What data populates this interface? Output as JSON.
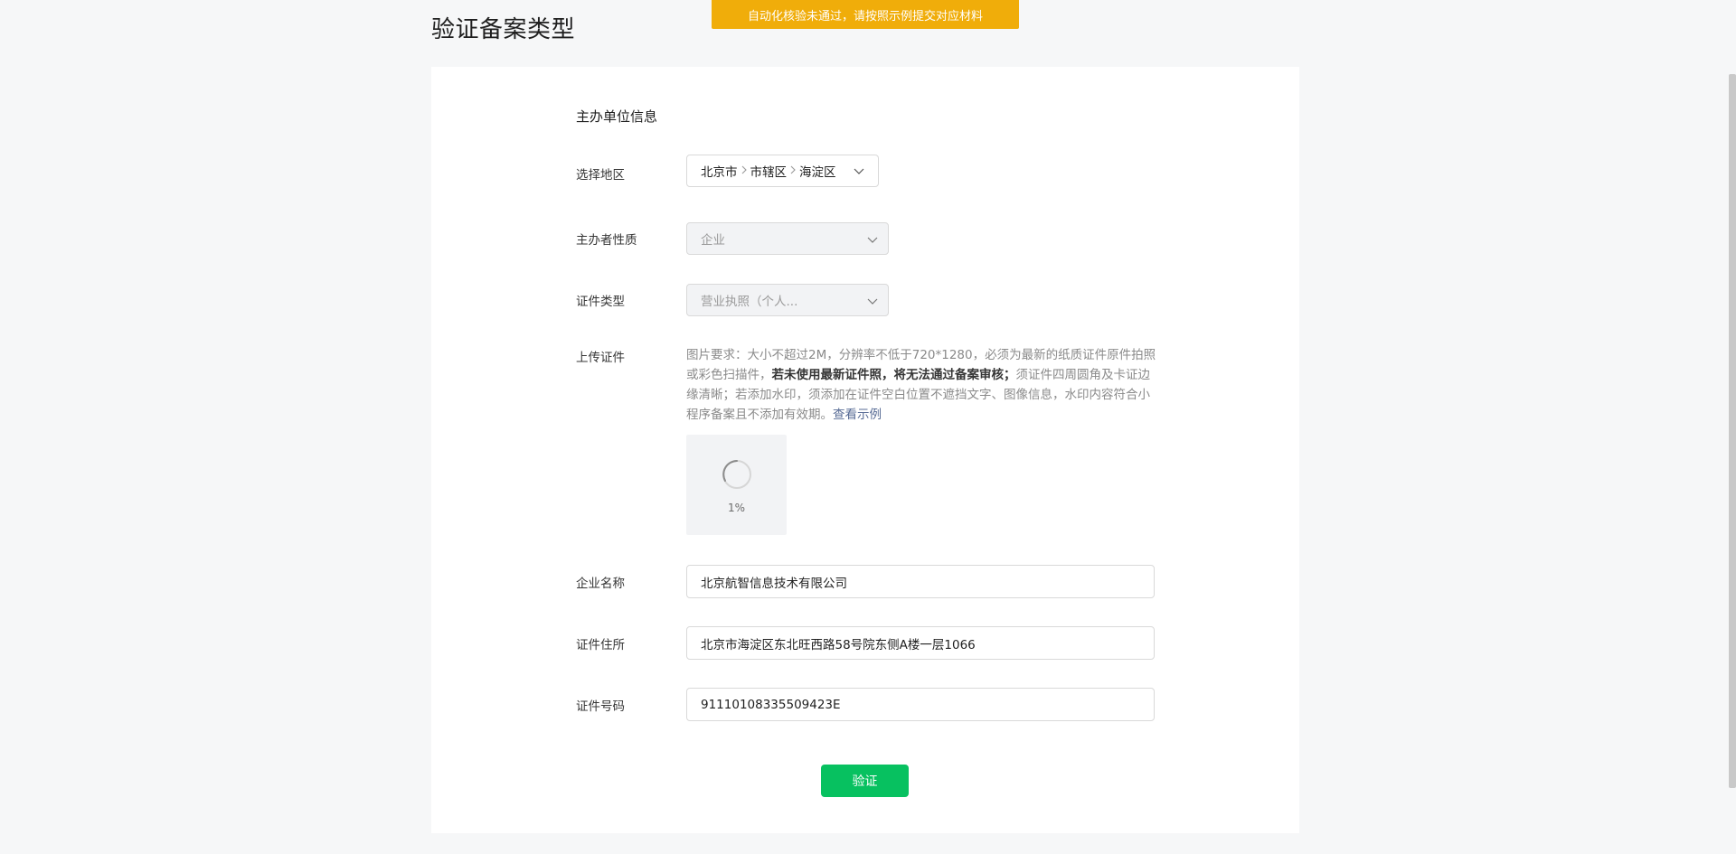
{
  "toast": {
    "message": "自动化核验未通过，请按照示例提交对应材料",
    "color": "#f0ad0a"
  },
  "page": {
    "title": "验证备案类型"
  },
  "form": {
    "section_title": "主办单位信息",
    "region": {
      "label": "选择地区",
      "parts": [
        "北京市",
        "市辖区",
        "海淀区"
      ],
      "separator": ">"
    },
    "organizer_nature": {
      "label": "主办者性质",
      "value": "企业"
    },
    "certificate_type": {
      "label": "证件类型",
      "value": "营业执照（个人..."
    },
    "upload": {
      "label": "上传证件",
      "desc_part1": "图片要求：大小不超过2M，分辨率不低于720*1280，必须为最新的纸质证件原件拍照或彩色扫描件，",
      "desc_bold": "若未使用最新证件照，将无法通过备案审核；",
      "desc_part2": "须证件四周圆角及卡证边缘清晰；若添加水印，须添加在证件空白位置不遮挡文字、图像信息，水印内容符合小程序备案且不添加有效期。",
      "link_text": "查看示例",
      "progress_text": "1%",
      "progress": 0.01
    },
    "company_name": {
      "label": "企业名称",
      "value": "北京航智信息技术有限公司"
    },
    "certificate_address": {
      "label": "证件住所",
      "value": "北京市海淀区东北旺西路58号院东侧A楼一层1066"
    },
    "certificate_number": {
      "label": "证件号码",
      "value": "91110108335509423E"
    },
    "submit_label": "验证"
  },
  "colors": {
    "primary": "#07c160",
    "link": "#576b95",
    "warning": "#f0ad0a"
  }
}
